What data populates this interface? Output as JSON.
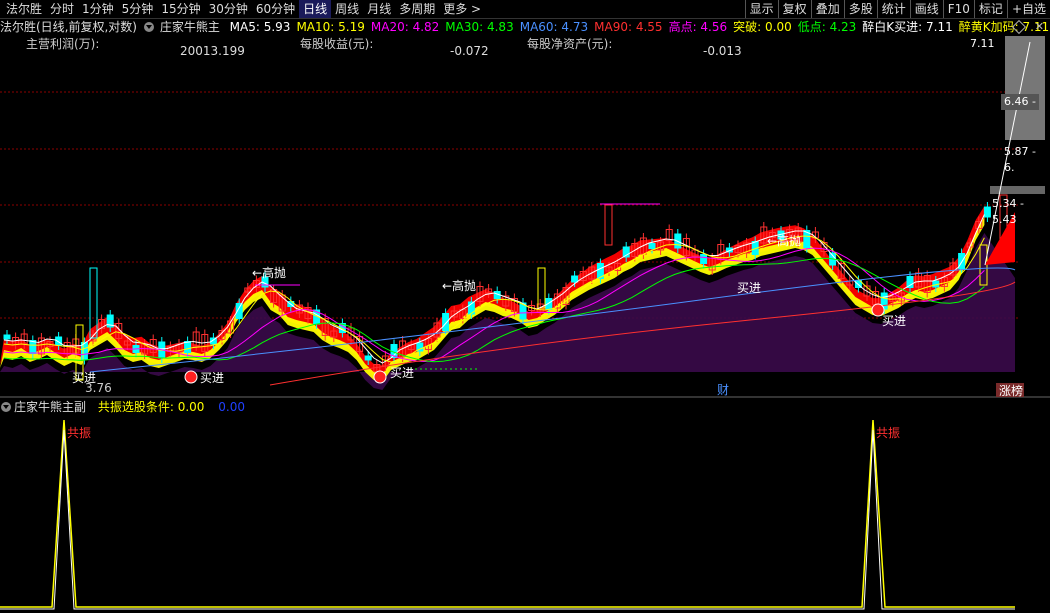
{
  "toolbar": {
    "app_title": "法尔胜",
    "periods": [
      "分时",
      "1分钟",
      "5分钟",
      "15分钟",
      "30分钟",
      "60分钟",
      "日线",
      "周线",
      "月线",
      "多周期",
      "更多 >"
    ],
    "active_period": "日线",
    "right_items": [
      "显示",
      "复权",
      "叠加",
      "多股",
      "统计",
      "画线",
      "F10",
      "标记",
      "+自选"
    ]
  },
  "legend": {
    "chart_mode": "法尔胜(日线,前复权,对数)",
    "indicator": "庄家牛熊主",
    "items": [
      {
        "label": "MA5: 5.93",
        "color": "#ffffff"
      },
      {
        "label": "MA10: 5.19",
        "color": "#ffff00"
      },
      {
        "label": "MA20: 4.82",
        "color": "#ff00ff"
      },
      {
        "label": "MA30: 4.83",
        "color": "#00ff00"
      },
      {
        "label": "MA60: 4.73",
        "color": "#4a90ff"
      },
      {
        "label": "MA90: 4.55",
        "color": "#ff3030"
      },
      {
        "label": "高点: 4.56",
        "color": "#ff00ff"
      },
      {
        "label": "突破: 0.00",
        "color": "#ffff00"
      },
      {
        "label": "低点: 4.23",
        "color": "#00ff00"
      },
      {
        "label": "醉白K买进: 7.11",
        "color": "#ffffff"
      },
      {
        "label": "醉黄K加码: 7.11",
        "color": "#ffff00"
      }
    ]
  },
  "finance": {
    "profit_label": "主营利润(万):",
    "profit_value": "20013.199",
    "eps_label": "每股收益(元):",
    "eps_value": "-0.072",
    "navps_label": "每股净资产(元):",
    "navps_value": "-0.013"
  },
  "price_scale": {
    "top": "7.11",
    "tag1": "6.46 -",
    "tag2": "5.87 - 6.",
    "tag3": "5.34 - 5.43"
  },
  "annotations": {
    "sell_high": "←高抛",
    "buy": "买进",
    "low_price": "3.76",
    "finance_marker": "财",
    "limit_list": "涨榜",
    "resonance": "共振"
  },
  "sub_legend": {
    "indicator": "庄家牛熊主副",
    "item_label": "共振选股条件: 0.00",
    "item_color": "#ffff00",
    "extra_value": "0.00",
    "extra_color": "#0000ff"
  },
  "colors": {
    "up": "#ff3030",
    "down": "#00ffff",
    "band_red": "#ff0000",
    "band_yellow": "#ffff00",
    "band_purple": "#3a0a4a",
    "grid": "#8b0000"
  }
}
